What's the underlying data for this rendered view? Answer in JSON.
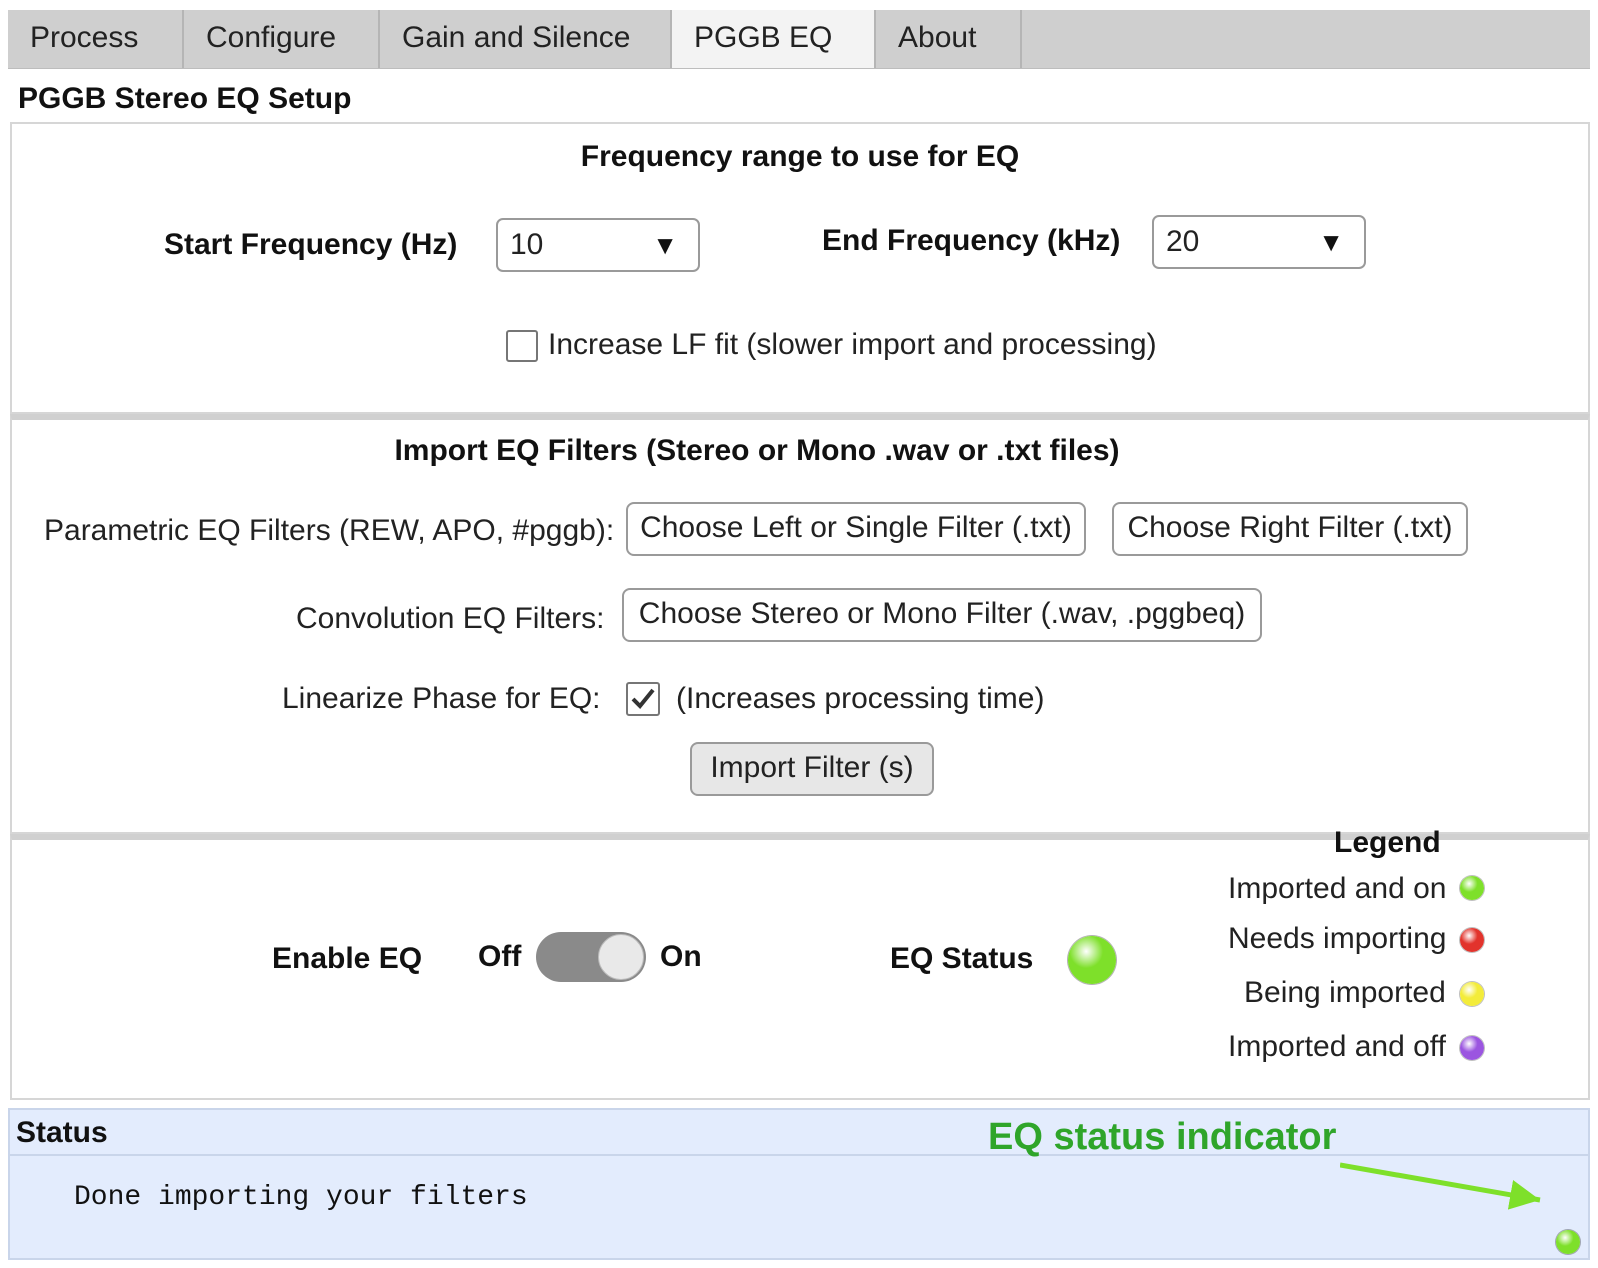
{
  "tabs": [
    {
      "label": "Process"
    },
    {
      "label": "Configure"
    },
    {
      "label": "Gain and Silence"
    },
    {
      "label": "PGGB EQ",
      "active": true
    },
    {
      "label": "About"
    }
  ],
  "header": {
    "title": "PGGB Stereo EQ Setup"
  },
  "frequency": {
    "title": "Frequency range to use for EQ",
    "start_label": "Start  Frequency (Hz)",
    "start_value": "10",
    "end_label": "End Frequency (kHz)",
    "end_value": "20",
    "lf_fit_label": "Increase LF fit (slower import and processing)",
    "lf_fit_checked": false
  },
  "import": {
    "title": "Import EQ Filters (Stereo or Mono .wav or .txt files)",
    "parametric_label": "Parametric EQ Filters (REW, APO, #pggb):",
    "left_button": "Choose Left or Single Filter (.txt)",
    "right_button": "Choose Right Filter (.txt)",
    "convolution_label": "Convolution EQ Filters:",
    "convolution_button": "Choose Stereo or Mono Filter (.wav, .pggbeq)",
    "linearize_label": "Linearize Phase for EQ:",
    "linearize_checked": true,
    "linearize_note": "(Increases processing time)",
    "import_button": "Import Filter (s)"
  },
  "enable": {
    "label": "Enable EQ",
    "off_label": "Off",
    "on_label": "On",
    "toggle_on": true,
    "status_label": "EQ Status",
    "status_color": "#7ee02a"
  },
  "legend": {
    "title": "Legend",
    "items": [
      {
        "label": "Imported and on",
        "color": "#7ee02a"
      },
      {
        "label": "Needs importing",
        "color": "#e2332c"
      },
      {
        "label": "Being imported",
        "color": "#f3ec3a"
      },
      {
        "label": "Imported and off",
        "color": "#9b55e0"
      }
    ]
  },
  "status": {
    "title": "Status",
    "message": "Done importing your filters",
    "indicator_color": "#7ee02a"
  },
  "annotation": {
    "text": "EQ status indicator",
    "color": "#2fa52a"
  },
  "icons": {
    "dropdown": "triangle-down-icon",
    "checkmark": "check-icon"
  }
}
